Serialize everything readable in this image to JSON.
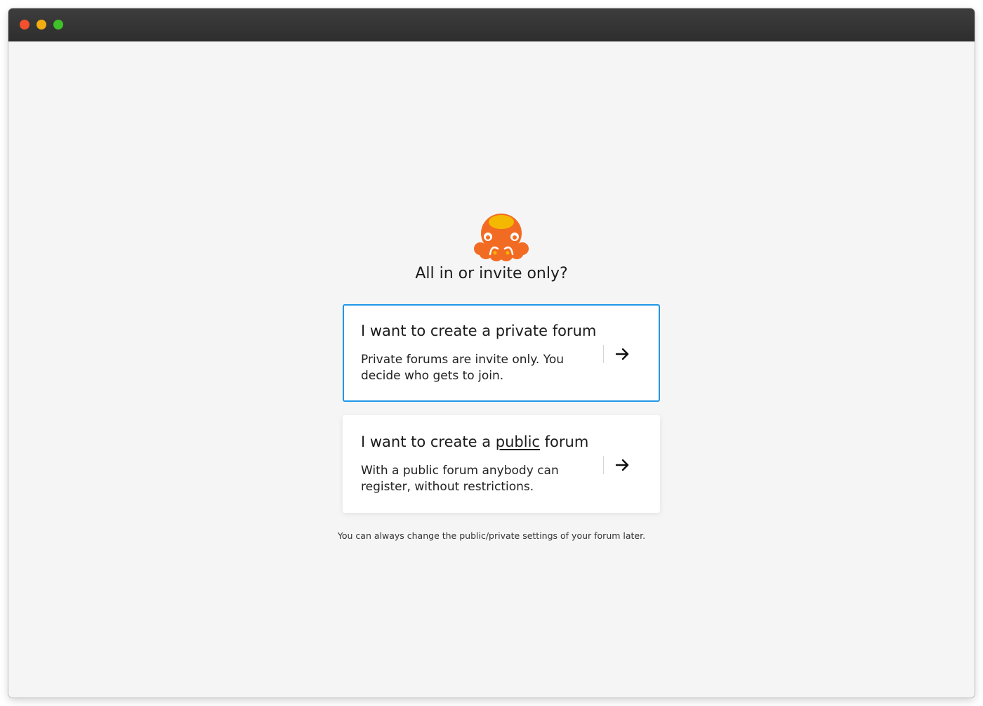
{
  "window": {
    "controls": [
      "close",
      "minimize",
      "zoom"
    ]
  },
  "page": {
    "logo_icon": "octopus-logo-icon",
    "heading": "All in or invite only?",
    "footnote": "You can always change the public/private settings of your forum later."
  },
  "options": [
    {
      "title": "I want to create a private forum",
      "description": "Private forums are invite only. You decide who gets to join.",
      "icon": "arrow-right-icon",
      "selected": true
    },
    {
      "title_prefix": "I want to create a ",
      "title_emphasis": "public",
      "title_suffix": " forum",
      "description": "With a public forum anybody can register, without restrictions.",
      "icon": "arrow-right-icon",
      "selected": false
    }
  ],
  "colors": {
    "accent": "#2196e8",
    "logo_orange": "#f26b22",
    "logo_yellow": "#f5b800"
  }
}
